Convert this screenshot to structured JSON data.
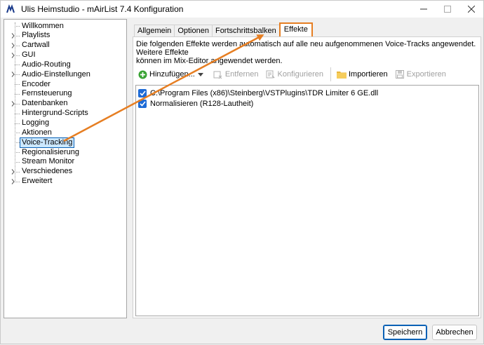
{
  "window": {
    "title": "Ulis Heimstudio - mAirList 7.4 Konfiguration"
  },
  "tree": {
    "items": [
      {
        "label": "Willkommen",
        "expandable": false
      },
      {
        "label": "Playlists",
        "expandable": true
      },
      {
        "label": "Cartwall",
        "expandable": true
      },
      {
        "label": "GUI",
        "expandable": true
      },
      {
        "label": "Audio-Routing",
        "expandable": false
      },
      {
        "label": "Audio-Einstellungen",
        "expandable": true
      },
      {
        "label": "Encoder",
        "expandable": false
      },
      {
        "label": "Fernsteuerung",
        "expandable": false
      },
      {
        "label": "Datenbanken",
        "expandable": true
      },
      {
        "label": "Hintergrund-Scripts",
        "expandable": false
      },
      {
        "label": "Logging",
        "expandable": false
      },
      {
        "label": "Aktionen",
        "expandable": false
      },
      {
        "label": "Voice-Tracking",
        "expandable": false,
        "selected": true
      },
      {
        "label": "Regionalisierung",
        "expandable": false
      },
      {
        "label": "Stream Monitor",
        "expandable": false
      },
      {
        "label": "Verschiedenes",
        "expandable": true
      },
      {
        "label": "Erweitert",
        "expandable": true
      }
    ]
  },
  "tabs": [
    {
      "label": "Allgemein",
      "active": false
    },
    {
      "label": "Optionen",
      "active": false
    },
    {
      "label": "Fortschrittsbalken",
      "active": false
    },
    {
      "label": "Effekte",
      "active": true
    }
  ],
  "effects_tab": {
    "description_line1": "Die folgenden Effekte werden automatisch auf alle neu aufgenommenen Voice-Tracks angewendet. Weitere Effekte",
    "description_line2": "können im Mix-Editor angewendet werden.",
    "toolbar": {
      "add_label": "Hinzufügen...",
      "remove_label": "Entfernen",
      "configure_label": "Konfigurieren",
      "import_label": "Importieren",
      "export_label": "Exportieren"
    },
    "effects": [
      {
        "label": "C:\\Program Files (x86)\\Steinberg\\VSTPlugins\\TDR Limiter 6 GE.dll",
        "checked": true
      },
      {
        "label": "Normalisieren (R128-Lautheit)",
        "checked": true
      }
    ]
  },
  "buttons": {
    "save_label": "Speichern",
    "cancel_label": "Abbrechen"
  },
  "colors": {
    "accent": "#1e6bd6",
    "annotation": "#e67e22",
    "selection_bg": "#cce8ff"
  }
}
